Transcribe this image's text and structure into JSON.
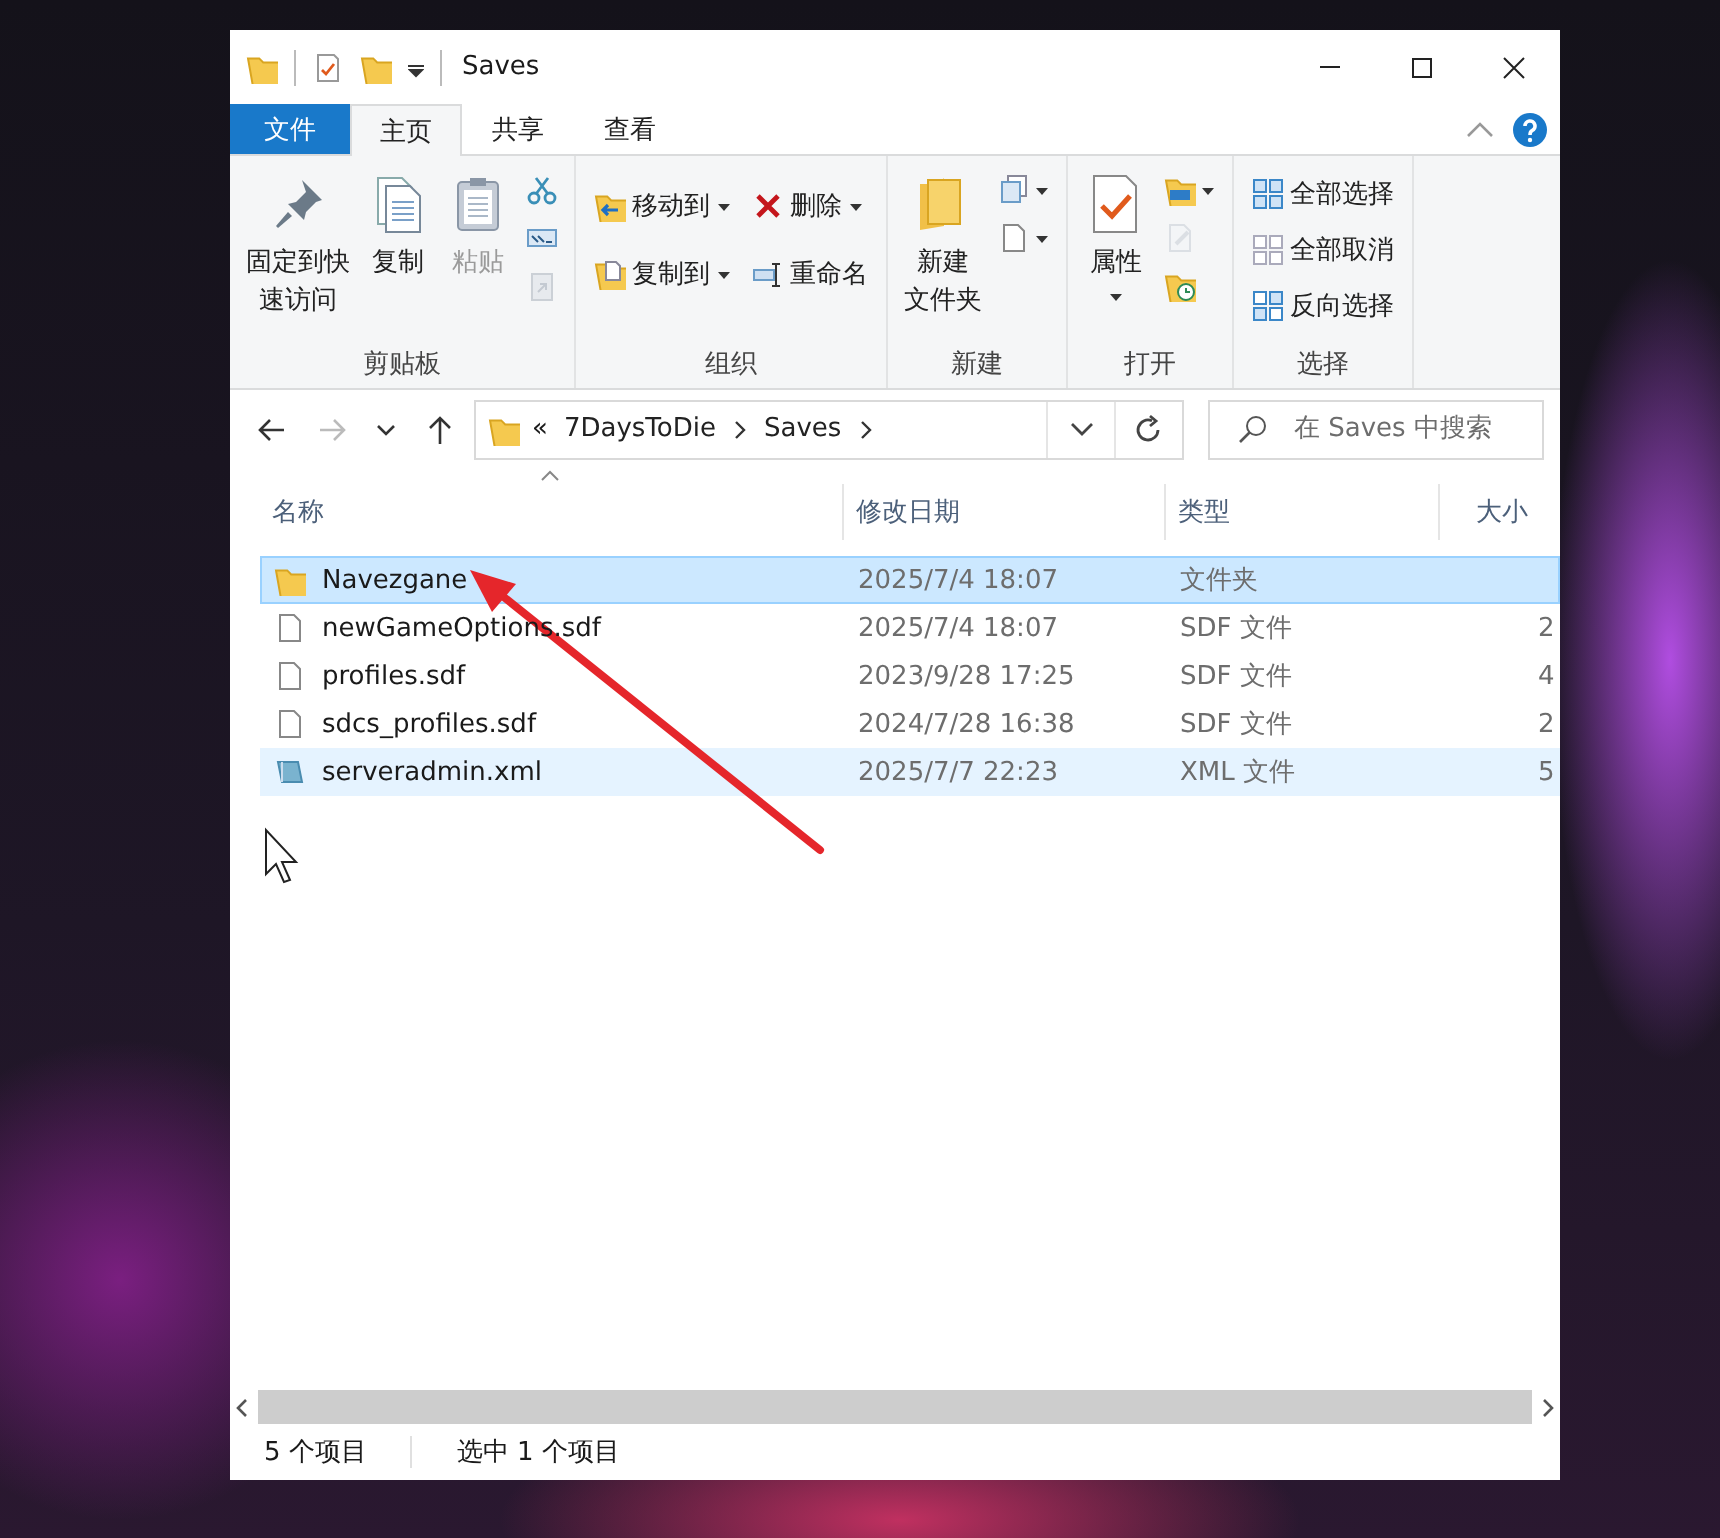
{
  "title_bar": {
    "title": "Saves"
  },
  "ribbon_tabs": [
    {
      "label": "文件",
      "kind": "file",
      "selected": false
    },
    {
      "label": "主页",
      "kind": "tab",
      "selected": true
    },
    {
      "label": "共享",
      "kind": "tab",
      "selected": false
    },
    {
      "label": "查看",
      "kind": "tab",
      "selected": false
    }
  ],
  "ribbon_groups": [
    {
      "label": "剪贴板",
      "columns": [
        [
          {
            "kind": "large",
            "lines": [
              "固定到快",
              "速访问"
            ],
            "dropdown": false,
            "disabled": false
          }
        ],
        [
          {
            "kind": "large",
            "lines": [
              "复制"
            ],
            "dropdown": false,
            "disabled": false
          }
        ],
        [
          {
            "kind": "large",
            "lines": [
              "粘贴"
            ],
            "dropdown": false,
            "disabled": true
          }
        ],
        [
          {
            "kind": "icon",
            "dropdown": false,
            "disabled": false
          },
          {
            "kind": "icon",
            "dropdown": false,
            "disabled": false
          },
          {
            "kind": "icon",
            "dropdown": false,
            "disabled": true
          }
        ]
      ]
    },
    {
      "label": "组织",
      "columns": [
        [
          {
            "kind": "small",
            "label": "移动到",
            "dropdown": true,
            "disabled": false
          },
          {
            "kind": "small",
            "label": "复制到",
            "dropdown": true,
            "disabled": false
          }
        ],
        [
          {
            "kind": "small",
            "label": "删除",
            "dropdown": true,
            "disabled": false
          },
          {
            "kind": "small",
            "label": "重命名",
            "dropdown": false,
            "disabled": false
          }
        ]
      ]
    },
    {
      "label": "新建",
      "columns": [
        [
          {
            "kind": "large",
            "lines": [
              "新建",
              "文件夹"
            ],
            "dropdown": false,
            "disabled": false
          }
        ],
        [
          {
            "kind": "icon",
            "dropdown": true,
            "disabled": false
          },
          {
            "kind": "icon",
            "dropdown": true,
            "disabled": false
          }
        ]
      ]
    },
    {
      "label": "打开",
      "columns": [
        [
          {
            "kind": "large",
            "lines": [
              "属性"
            ],
            "dropdown": true,
            "disabled": false
          }
        ],
        [
          {
            "kind": "icon",
            "dropdown": true,
            "disabled": false
          },
          {
            "kind": "icon",
            "dropdown": false,
            "disabled": true
          },
          {
            "kind": "icon",
            "dropdown": false,
            "disabled": false
          }
        ]
      ]
    },
    {
      "label": "选择",
      "columns": [
        [
          {
            "kind": "small",
            "label": "全部选择",
            "dropdown": false,
            "disabled": false
          },
          {
            "kind": "small",
            "label": "全部取消",
            "dropdown": false,
            "disabled": false
          },
          {
            "kind": "small",
            "label": "反向选择",
            "dropdown": false,
            "disabled": false
          }
        ]
      ]
    }
  ],
  "address_bar": {
    "overflow": "«",
    "path": [
      "7DaysToDie",
      "Saves"
    ],
    "forward_disabled": true
  },
  "search": {
    "placeholder": "在 Saves 中搜索"
  },
  "columns": [
    "名称",
    "修改日期",
    "类型",
    "大小"
  ],
  "rows": [
    {
      "kind": "folder",
      "name": "Navezgane",
      "date": "2025/7/4 18:07",
      "type": "文件夹",
      "size": "",
      "selected": true,
      "hovered": false
    },
    {
      "kind": "file",
      "name": "newGameOptions.sdf",
      "date": "2025/7/4 18:07",
      "type": "SDF 文件",
      "size": "2",
      "selected": false,
      "hovered": false
    },
    {
      "kind": "file",
      "name": "profiles.sdf",
      "date": "2023/9/28 17:25",
      "type": "SDF 文件",
      "size": "4",
      "selected": false,
      "hovered": false
    },
    {
      "kind": "file",
      "name": "sdcs_profiles.sdf",
      "date": "2024/7/28 16:38",
      "type": "SDF 文件",
      "size": "2",
      "selected": false,
      "hovered": false
    },
    {
      "kind": "xml",
      "name": "serveradmin.xml",
      "date": "2025/7/7 22:23",
      "type": "XML 文件",
      "size": "5",
      "selected": false,
      "hovered": true
    }
  ],
  "status_bar": {
    "count": "5 个项目",
    "selection": "选中 1 个项目"
  }
}
